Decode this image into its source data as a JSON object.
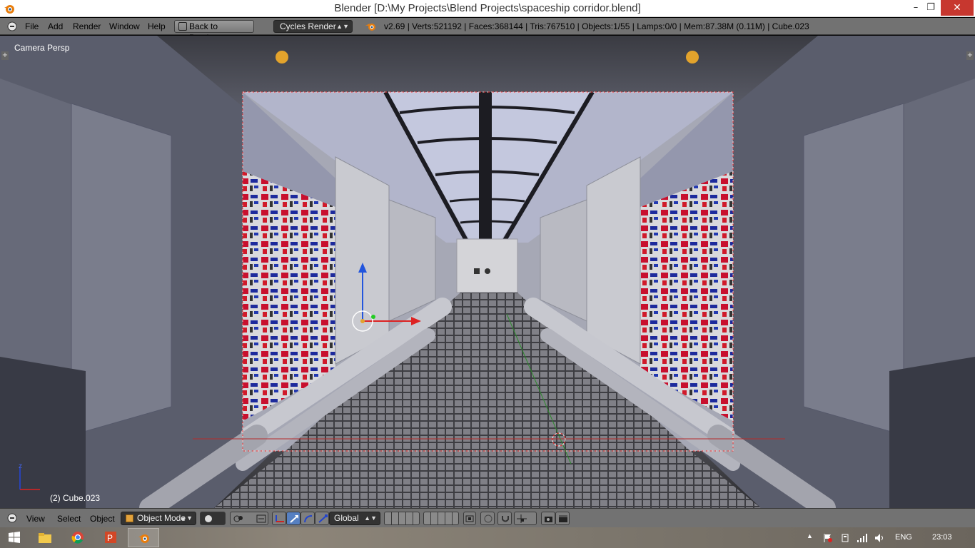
{
  "window": {
    "title": "Blender [D:\\My Projects\\Blend Projects\\spaceship corridor.blend]",
    "controls": [
      "minimize",
      "maximize",
      "close"
    ]
  },
  "info_header": {
    "menus": [
      "File",
      "Add",
      "Render",
      "Window",
      "Help"
    ],
    "back_button": "Back to Previous",
    "render_engine": "Cycles Render",
    "stats": "v2.69 | Verts:521192 | Faces:368144 | Tris:767510 | Objects:1/55 | Lamps:0/0 | Mem:87.38M (0.11M) | Cube.023"
  },
  "viewport": {
    "view_name": "Camera Persp",
    "active_object": "(2) Cube.023",
    "axis_z_label": "z"
  },
  "view3d_header": {
    "menus": [
      "View",
      "Select",
      "Object"
    ],
    "mode": "Object Mode",
    "orientation": "Global"
  },
  "taskbar": {
    "apps": [
      "start-icon",
      "file-explorer-icon",
      "chrome-icon",
      "powerpoint-icon",
      "blender-icon"
    ],
    "language": "ENG",
    "time": "23:03"
  }
}
